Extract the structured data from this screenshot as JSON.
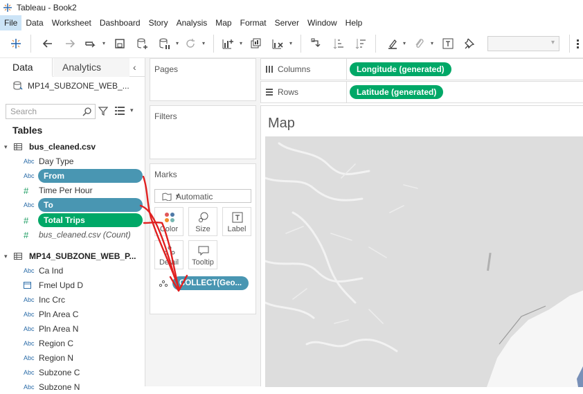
{
  "window": {
    "title": "Tableau - Book2"
  },
  "menu": [
    "File",
    "Data",
    "Worksheet",
    "Dashboard",
    "Story",
    "Analysis",
    "Map",
    "Format",
    "Server",
    "Window",
    "Help"
  ],
  "datapane": {
    "tab_data": "Data",
    "tab_analytics": "Analytics",
    "datasource": "MP14_SUBZONE_WEB_...",
    "search_placeholder": "Search",
    "tables_heading": "Tables",
    "table1": {
      "name": "bus_cleaned.csv",
      "fields": [
        {
          "type": "Abc",
          "name": "Day Type"
        },
        {
          "type": "Abc",
          "name": "From"
        },
        {
          "type": "#",
          "name": "Time Per Hour"
        },
        {
          "type": "Abc",
          "name": "To"
        },
        {
          "type": "#",
          "name": "Total Trips"
        },
        {
          "type": "#",
          "name": "bus_cleaned.csv (Count)"
        }
      ]
    },
    "table2": {
      "name": "MP14_SUBZONE_WEB_P...",
      "fields": [
        {
          "type": "Abc",
          "name": "Ca Ind"
        },
        {
          "type": "date",
          "name": "Fmel Upd D"
        },
        {
          "type": "Abc",
          "name": "Inc Crc"
        },
        {
          "type": "Abc",
          "name": "Pln Area C"
        },
        {
          "type": "Abc",
          "name": "Pln Area N"
        },
        {
          "type": "Abc",
          "name": "Region C"
        },
        {
          "type": "Abc",
          "name": "Region N"
        },
        {
          "type": "Abc",
          "name": "Subzone C"
        },
        {
          "type": "Abc",
          "name": "Subzone N"
        }
      ]
    }
  },
  "cards": {
    "pages": "Pages",
    "filters": "Filters",
    "marks": "Marks",
    "mark_type": "Automatic",
    "buttons": [
      "Color",
      "Size",
      "Label",
      "Detail",
      "Tooltip"
    ],
    "collect_pill": "COLLECT(Geo..."
  },
  "shelves": {
    "columns_label": "Columns",
    "columns_pill": "Longitude (generated)",
    "rows_label": "Rows",
    "rows_pill": "Latitude (generated)"
  },
  "view": {
    "title": "Map"
  },
  "colors": {
    "dimension": "#4996b2",
    "measure": "#00a867",
    "annotation": "#e02020"
  }
}
